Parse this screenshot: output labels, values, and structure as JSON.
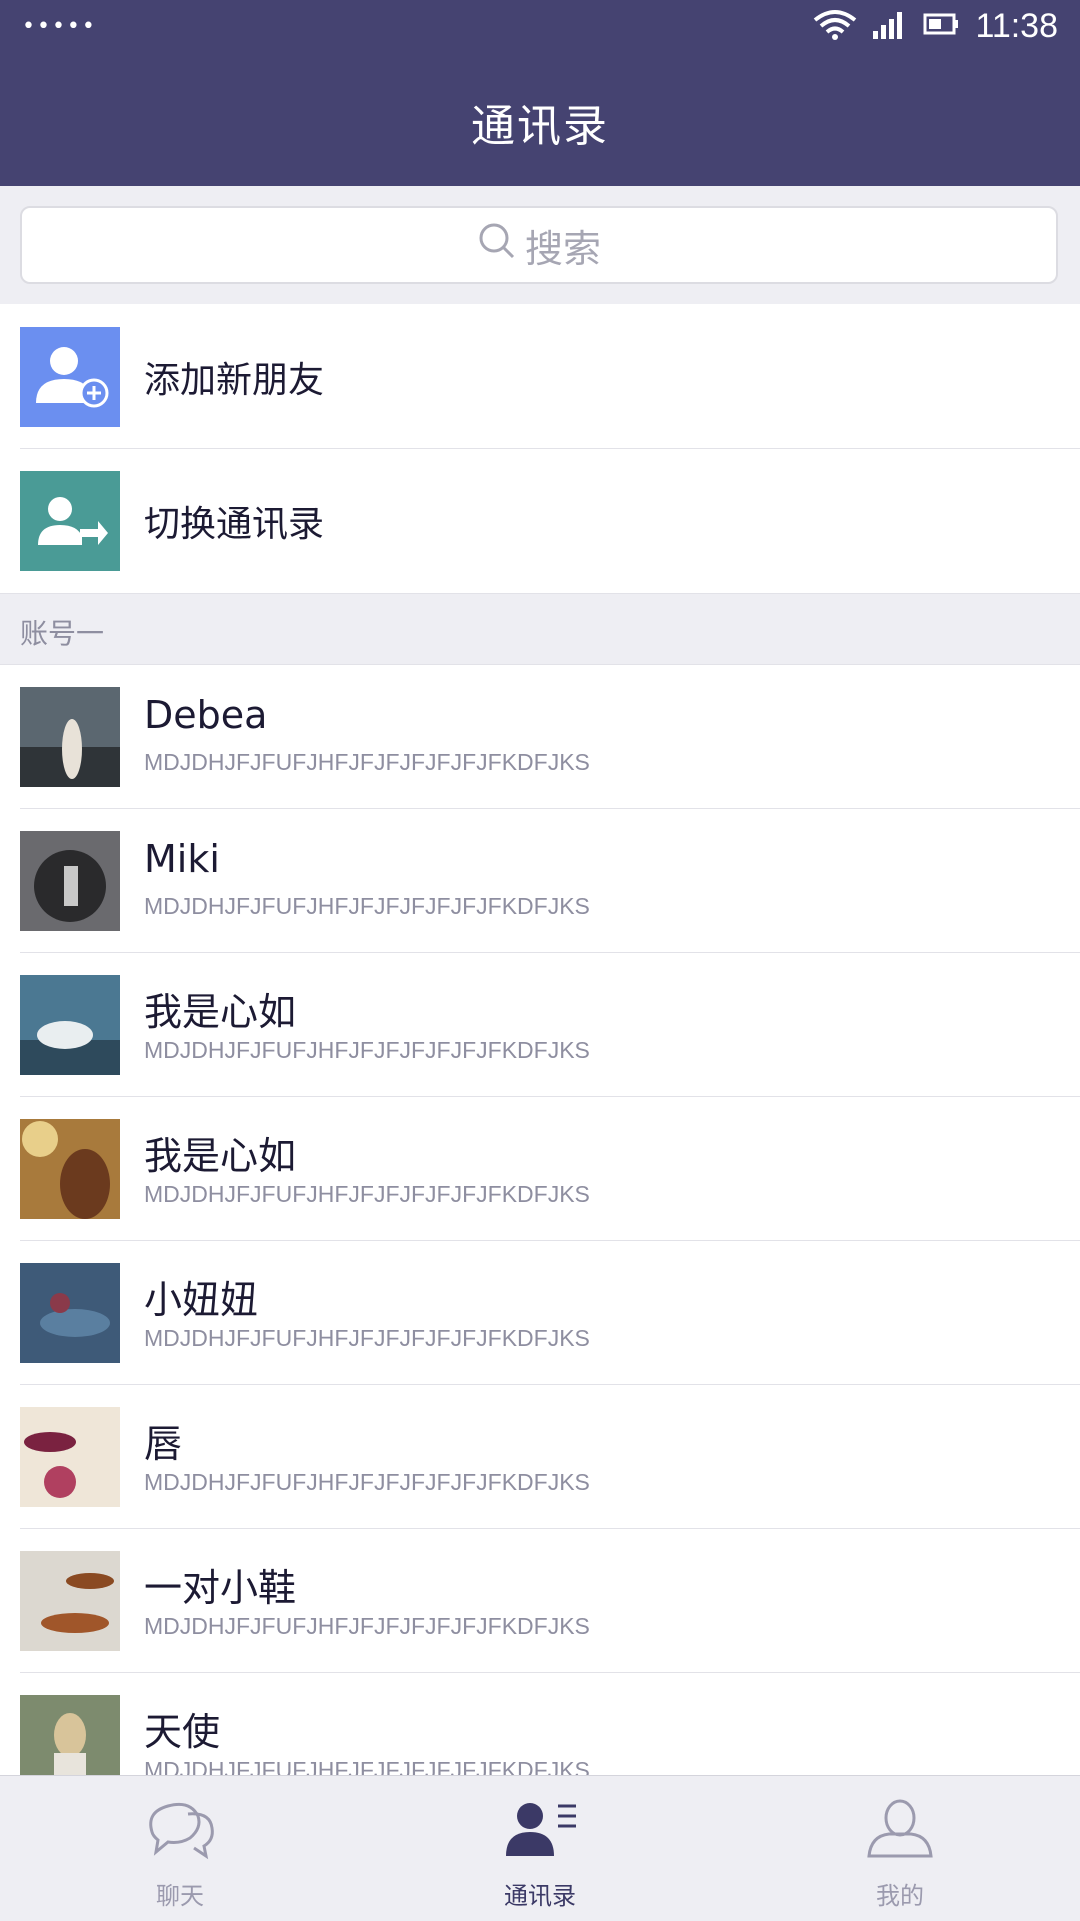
{
  "status_bar": {
    "signal_dots": "•••••",
    "time": "11:38",
    "icons": [
      "wifi-icon",
      "cellular-signal-icon",
      "battery-icon"
    ]
  },
  "header": {
    "title": "通讯录"
  },
  "search": {
    "placeholder": "搜索",
    "icon": "search-icon"
  },
  "actions": [
    {
      "label": "添加新朋友",
      "icon": "add-friend-icon",
      "color": "#6b8ff0"
    },
    {
      "label": "切换通讯录",
      "icon": "switch-contacts-icon",
      "color": "#4a9b96"
    }
  ],
  "section": {
    "title": "账号一"
  },
  "contacts": [
    {
      "name": "Debea",
      "sub": "MDJDHJFJFUFJHFJFJFJFJFJFJFKDFJKS",
      "avatar_color": "#5b6770"
    },
    {
      "name": "Miki",
      "sub": "MDJDHJFJFUFJHFJFJFJFJFJFJFKDFJKS",
      "avatar_color": "#6a6a6e"
    },
    {
      "name": "我是心如",
      "sub": "MDJDHJFJFUFJHFJFJFJFJFJFJFKDFJKS",
      "avatar_color": "#4b7892"
    },
    {
      "name": "我是心如",
      "sub": "MDJDHJFJFUFJHFJFJFJFJFJFJFKDFJKS",
      "avatar_color": "#a87a3c"
    },
    {
      "name": "小妞妞",
      "sub": "MDJDHJFJFUFJHFJFJFJFJFJFJFKDFJKS",
      "avatar_color": "#3e5a78"
    },
    {
      "name": "唇",
      "sub": "MDJDHJFJFUFJHFJFJFJFJFJFJFKDFJKS",
      "avatar_color": "#c9a8b0"
    },
    {
      "name": "一对小鞋",
      "sub": "MDJDHJFJFUFJHFJFJFJFJFJFJFKDFJKS",
      "avatar_color": "#9a7a62"
    },
    {
      "name": "天使",
      "sub": "MDJDHJFJFUFJHFJFJFJFJFJFJFKDFJKS",
      "avatar_color": "#7d8b6e"
    }
  ],
  "tabs": [
    {
      "label": "聊天",
      "icon": "chat-icon",
      "active": false
    },
    {
      "label": "通讯录",
      "icon": "contacts-icon",
      "active": true
    },
    {
      "label": "我的",
      "icon": "profile-icon",
      "active": false
    }
  ],
  "colors": {
    "header_bg": "#454371",
    "active_tab": "#3b3966",
    "inactive_tab": "#9b9aae",
    "page_bg": "#eeeef3"
  }
}
